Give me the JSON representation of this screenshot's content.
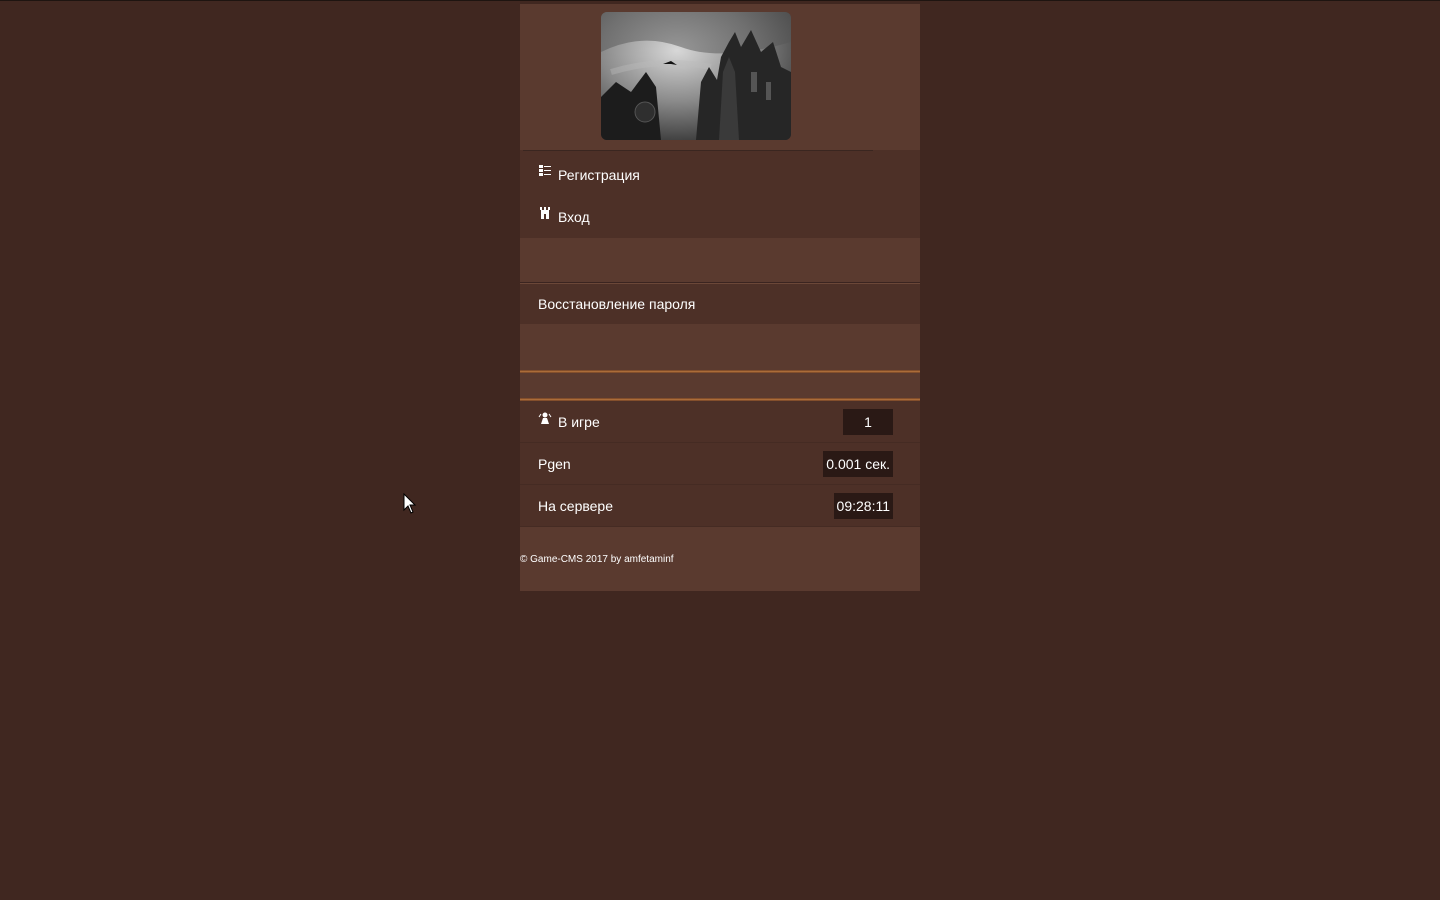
{
  "menu": {
    "register_label": "Регистрация",
    "login_label": "Вход"
  },
  "recovery": {
    "label": "Восстановление пароля"
  },
  "stats": {
    "in_game_label": "В игре",
    "in_game_value": "1",
    "pgen_label": "Pgen",
    "pgen_value": "0.001 сек.",
    "server_label": "На сервере",
    "server_value": "09:28:11"
  },
  "footer": {
    "copyright": "© Game-CMS 2017 by amfetaminf"
  },
  "colors": {
    "page_bg": "#402720",
    "panel_bg": "#5a3a2f",
    "row_bg": "#4d3027",
    "accent_copper": "#b8763e"
  }
}
